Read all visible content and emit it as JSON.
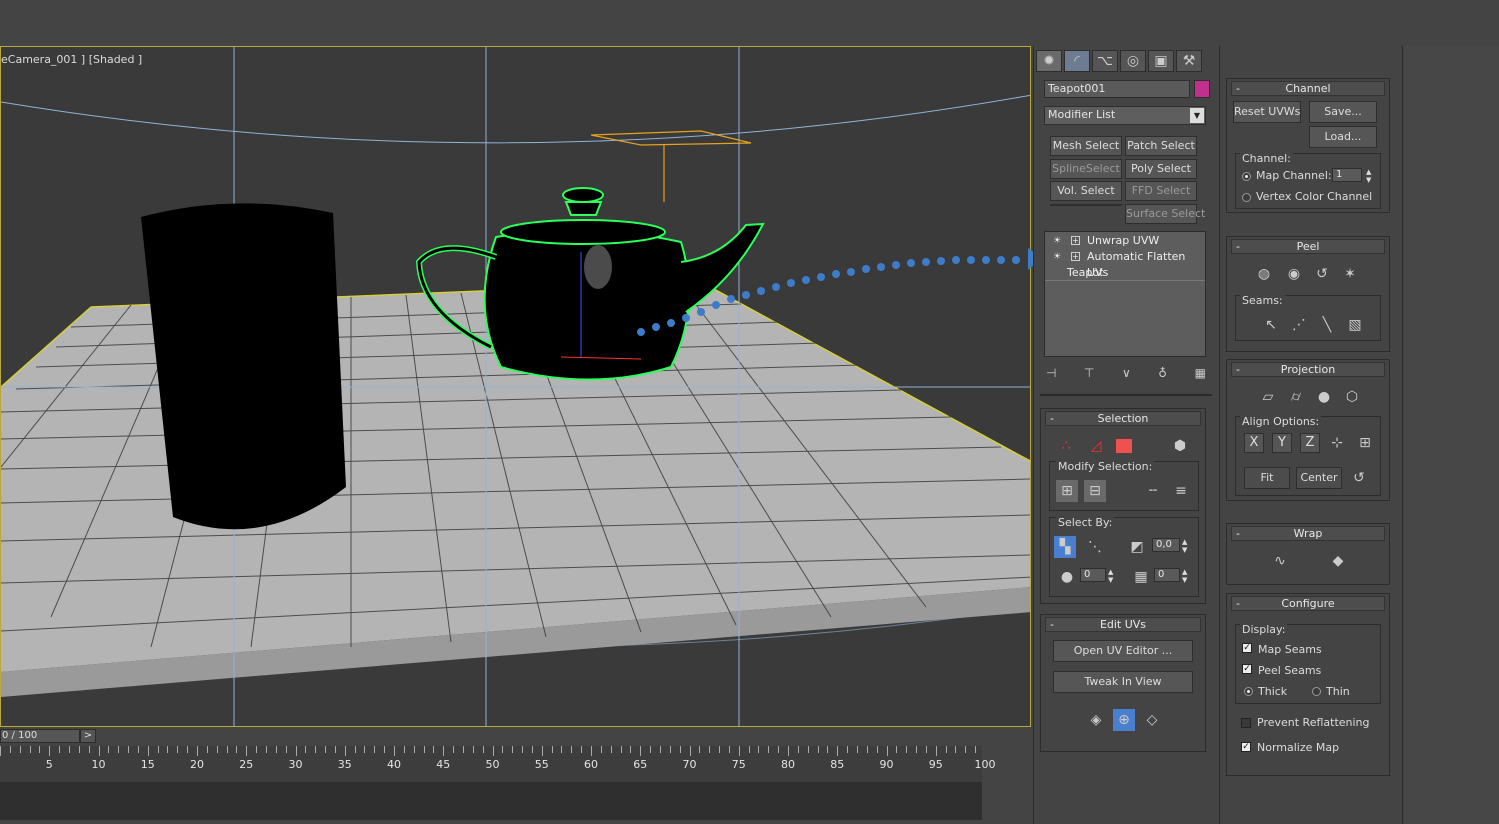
{
  "viewport": {
    "label": "eCamera_001 ] [Shaded ]"
  },
  "timeline": {
    "frame_display": "0 / 100",
    "next_arrow": ">",
    "ticks": [
      "5",
      "10",
      "15",
      "20",
      "25",
      "30",
      "35",
      "40",
      "45",
      "50",
      "55",
      "60",
      "65",
      "70",
      "75",
      "80",
      "85",
      "90",
      "95",
      "100"
    ]
  },
  "command_panel": {
    "object_name": "Teapot001",
    "object_color": "#c0308c",
    "modifier_list": "Modifier List",
    "quick_buttons": [
      "Mesh Select",
      "Patch Select",
      "SplineSelect",
      "Poly Select",
      "Vol. Select",
      "FFD Select",
      "",
      "Surface Select"
    ],
    "stack": [
      "Unwrap UVW",
      "Automatic Flatten UVs",
      "Teapot"
    ]
  },
  "selection": {
    "title": "Selection",
    "modify_selection": "Modify Selection:",
    "select_by": "Select By:",
    "threshold": "0,0",
    "spin1": "0",
    "spin2": "0"
  },
  "edit_uvs": {
    "title": "Edit UVs",
    "open_editor": "Open UV Editor ...",
    "tweak": "Tweak In View"
  },
  "channel": {
    "title": "Channel",
    "reset": "Reset UVWs",
    "save": "Save...",
    "load": "Load...",
    "group": "Channel:",
    "map_channel_label": "Map Channel:",
    "map_channel_value": "1",
    "vertex_color": "Vertex Color Channel"
  },
  "peel": {
    "title": "Peel",
    "seams": "Seams:"
  },
  "projection": {
    "title": "Projection",
    "align": "Align Options:",
    "x": "X",
    "y": "Y",
    "z": "Z",
    "fit": "Fit",
    "center": "Center"
  },
  "wrap": {
    "title": "Wrap"
  },
  "configure": {
    "title": "Configure",
    "display": "Display:",
    "map_seams": "Map Seams",
    "peel_seams": "Peel Seams",
    "thick": "Thick",
    "thin": "Thin",
    "prevent": "Prevent Reflattening",
    "normalize": "Normalize Map"
  },
  "minus": "-"
}
